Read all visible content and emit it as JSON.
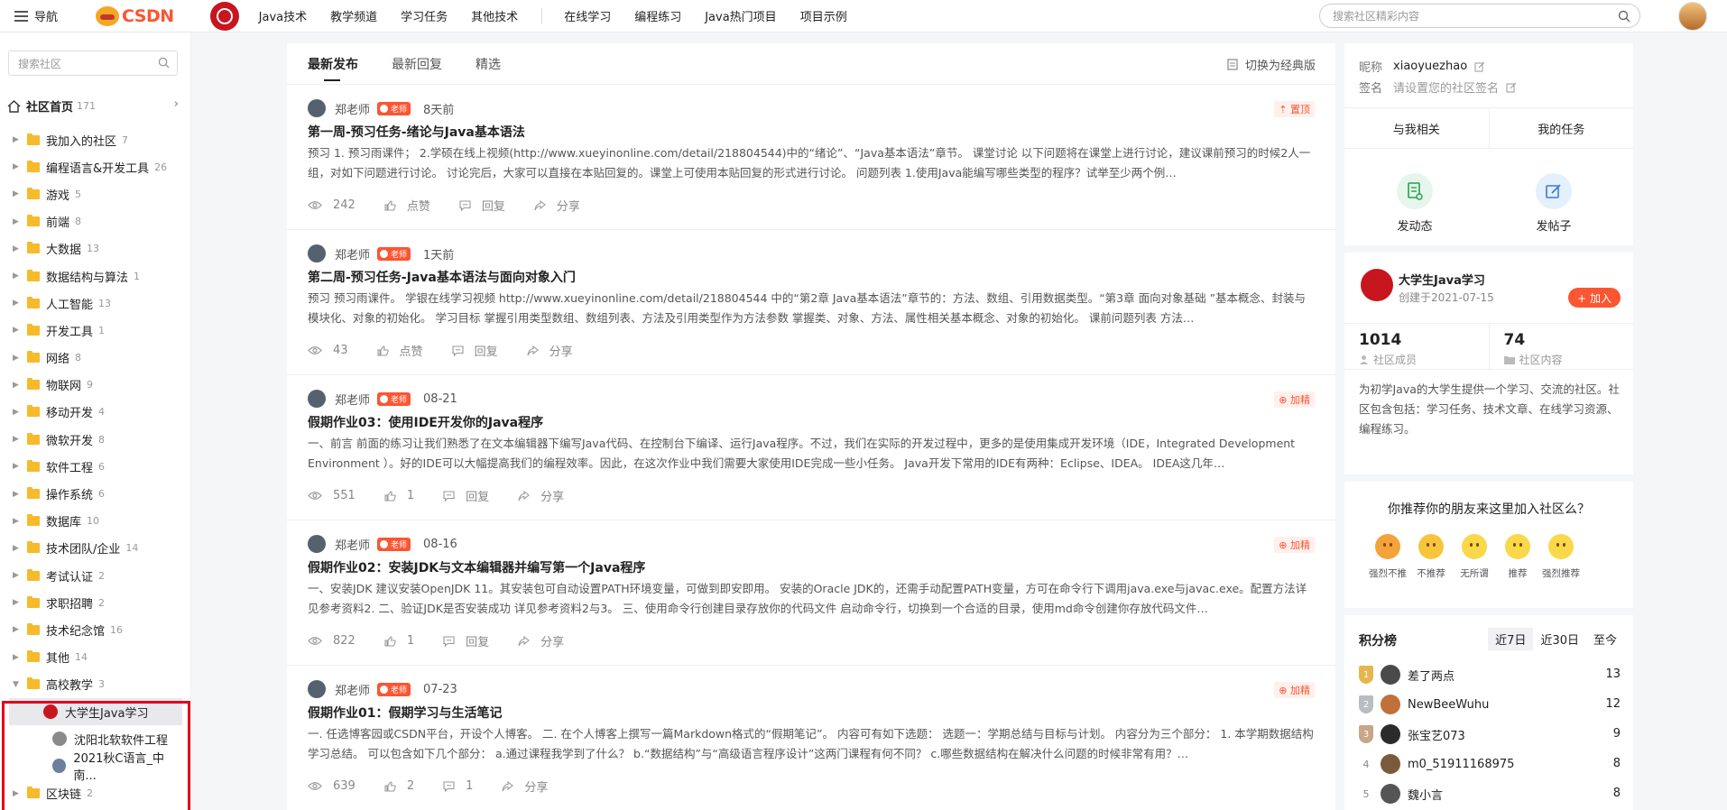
{
  "topbar": {
    "nav_label": "导航",
    "logo_text": "CSDN",
    "nav_links": [
      "Java技术",
      "教学频道",
      "学习任务",
      "其他技术"
    ],
    "nav_links2": [
      "在线学习",
      "编程练习",
      "Java热门项目",
      "项目示例"
    ],
    "search_placeholder": "搜索社区精彩内容"
  },
  "sidebar": {
    "search_placeholder": "搜索社区",
    "home_label": "社区首页",
    "home_count": "171",
    "categories": [
      {
        "label": "我加入的社区",
        "count": "7"
      },
      {
        "label": "编程语言&开发工具",
        "count": "26"
      },
      {
        "label": "游戏",
        "count": "5"
      },
      {
        "label": "前端",
        "count": "8"
      },
      {
        "label": "大数据",
        "count": "13"
      },
      {
        "label": "数据结构与算法",
        "count": "1"
      },
      {
        "label": "人工智能",
        "count": "13"
      },
      {
        "label": "开发工具",
        "count": "1"
      },
      {
        "label": "网络",
        "count": "8"
      },
      {
        "label": "物联网",
        "count": "9"
      },
      {
        "label": "移动开发",
        "count": "4"
      },
      {
        "label": "微软开发",
        "count": "8"
      },
      {
        "label": "软件工程",
        "count": "6"
      },
      {
        "label": "操作系统",
        "count": "6"
      },
      {
        "label": "数据库",
        "count": "10"
      },
      {
        "label": "技术团队/企业",
        "count": "14"
      },
      {
        "label": "考试认证",
        "count": "2"
      },
      {
        "label": "求职招聘",
        "count": "2"
      },
      {
        "label": "技术纪念馆",
        "count": "16"
      },
      {
        "label": "其他",
        "count": "14"
      }
    ],
    "expanded": {
      "label": "高校教学",
      "count": "3"
    },
    "sub_items": [
      {
        "label": "大学生Java学习",
        "color": "#c7161e"
      },
      {
        "label": "沈阳北软软件工程",
        "color": "#8a8a8a"
      },
      {
        "label": "2021秋C语言_中南...",
        "color": "#6d7f9c"
      }
    ],
    "last": {
      "label": "区块链",
      "count": "2"
    }
  },
  "feed": {
    "tabs": [
      "最新发布",
      "最新回复",
      "精选"
    ],
    "switch_label": "切换为经典版",
    "posts": [
      {
        "author": "郑老师",
        "badge": "老师",
        "time": "8天前",
        "tag": "置顶",
        "title": "第一周-预习任务-绪论与Java基本语法",
        "excerpt": "预习 1. 预习雨课件； 2.学硕在线上视频(http://www.xueyinonline.com/detail/218804544)中的“绪论”、“Java基本语法”章节。 课堂讨论 以下问题将在课堂上进行讨论，建议课前预习的时候2人一组，对如下问题进行讨论。 讨论完后，大家可以直接在本贴回复的。课堂上可使用本贴回复的形式进行讨论。 问题列表 1.使用Java能编写哪些类型的程序？试举至少两个例…",
        "views": "242",
        "likes": "点赞",
        "replies": "回复",
        "share": "分享"
      },
      {
        "author": "郑老师",
        "badge": "老师",
        "time": "1天前",
        "tag": "",
        "title": "第二周-预习任务-Java基本语法与面向对象入门",
        "excerpt": "预习 预习雨课件。 学银在线学习视频 http://www.xueyinonline.com/detail/218804544 中的“第2章 Java基本语法”章节的：方法、数组、引用数据类型。“第3章 面向对象基础 ”基本概念、封装与模块化、对象的初始化。 学习目标 掌握引用类型数组、数组列表、方法及引用类型作为方法参数 掌握类、对象、方法、属性相关基本概念、对象的初始化。 课前问题列表 方法…",
        "views": "43",
        "likes": "点赞",
        "replies": "回复",
        "share": "分享"
      },
      {
        "author": "郑老师",
        "badge": "老师",
        "time": "08-21",
        "tag": "加精",
        "title": "假期作业03：使用IDE开发你的Java程序",
        "excerpt": "一、前言 前面的练习让我们熟悉了在文本编辑器下编写Java代码、在控制台下编译、运行Java程序。不过，我们在实际的开发过程中，更多的是使用集成开发环境（IDE，Integrated Development Environment ）。好的IDE可以大幅提高我们的编程效率。因此，在这次作业中我们需要大家使用IDE完成一些小任务。 Java开发下常用的IDE有两种：Eclipse、IDEA。 IDEA这几年…",
        "views": "551",
        "likes": "1",
        "replies": "回复",
        "share": "分享"
      },
      {
        "author": "郑老师",
        "badge": "老师",
        "time": "08-16",
        "tag": "加精",
        "title": "假期作业02：安装JDK与文本编辑器并编写第一个Java程序",
        "excerpt": "一、安装JDK 建议安装OpenJDK 11。其安装包可自动设置PATH环境变量，可做到即安即用。 安装的Oracle JDK的，还需手动配置PATH变量，方可在命令行下调用java.exe与javac.exe。配置方法详见参考资料2. 二、验证JDK是否安装成功 详见参考资料2与3。 三、使用命令行创建目录存放你的代码文件 启动命令行，切换到一个合适的目录，使用md命令创建你存放代码文件…",
        "views": "822",
        "likes": "1",
        "replies": "回复",
        "share": "分享"
      },
      {
        "author": "郑老师",
        "badge": "老师",
        "time": "07-23",
        "tag": "加精",
        "title": "假期作业01：假期学习与生活笔记",
        "excerpt": "一. 任选博客园或CSDN平台，开设个人博客。 二. 在个人博客上撰写一篇Markdown格式的“假期笔记”。 内容可有如下选题： 选题一：学期总结与目标与计划。 内容分为三个部分： 1. 本学期数据结构学习总结。 可以包含如下几个部分： a.通过课程我学到了什么？ b.“数据结构”与“高级语言程序设计”这两门课程有何不同？ c.哪些数据结构在解决什么问题的时候非常有用？…",
        "views": "639",
        "likes": "2",
        "replies": "1",
        "share": "分享"
      }
    ]
  },
  "profile": {
    "nick_label": "昵称",
    "nick_value": "xiaoyuezhao",
    "sign_label": "签名",
    "sign_value": "请设置您的社区签名",
    "tab_related": "与我相关",
    "tab_tasks": "我的任务",
    "post_dynamic": "发动态",
    "post_thread": "发帖子"
  },
  "community": {
    "name": "大学生Java学习",
    "created": "创建于2021-07-15",
    "join_label": "+ 加入",
    "members": "1014",
    "members_label": "社区成员",
    "contents": "74",
    "contents_label": "社区内容",
    "desc": "为初学Java的大学生提供一个学习、交流的社区。社区包含包括：学习任务、技术文章、在线学习资源、编程练习。"
  },
  "recommend": {
    "question": "你推荐你的朋友来这里加入社区么？",
    "options": [
      {
        "label": "强烈不推",
        "color": "#f4a23a"
      },
      {
        "label": "不推荐",
        "color": "#f7c53d"
      },
      {
        "label": "无所谓",
        "color": "#f9d84a"
      },
      {
        "label": "推荐",
        "color": "#f9d84a"
      },
      {
        "label": "强烈推荐",
        "color": "#f9d84a"
      }
    ]
  },
  "ranking": {
    "title": "积分榜",
    "tabs": [
      "近7日",
      "近30日",
      "至今"
    ],
    "rows": [
      {
        "rank": "1",
        "name": "差了两点",
        "score": "13"
      },
      {
        "rank": "2",
        "name": "NewBeeWuhu",
        "score": "12"
      },
      {
        "rank": "3",
        "name": "张宝艺073",
        "score": "9"
      },
      {
        "rank": "4",
        "name": "m0_51911168975",
        "score": "8"
      },
      {
        "rank": "5",
        "name": "魏小言",
        "score": "8"
      }
    ]
  }
}
